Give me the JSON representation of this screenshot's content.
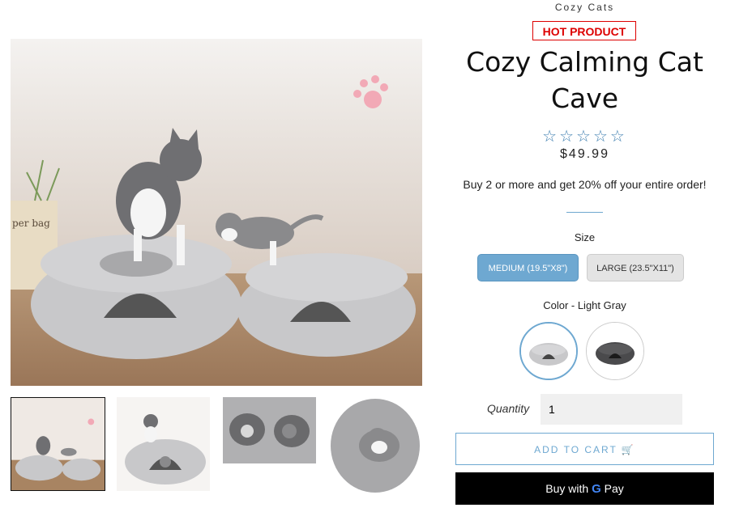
{
  "store": {
    "brand": "Cozy Cats"
  },
  "product": {
    "badge": "HOT PRODUCT",
    "title": "Cozy Calming Cat Cave",
    "rating_stars": "☆☆☆☆☆",
    "price": "$49.99",
    "promo": "Buy 2 or more and get 20% off your entire order!"
  },
  "size": {
    "label": "Size",
    "options": [
      "MEDIUM (19.5\"X8\")",
      "LARGE (23.5\"X11\")"
    ],
    "selected": "MEDIUM (19.5\"X8\")"
  },
  "color": {
    "label": "Color - Light Gray",
    "options": [
      "Light Gray",
      "Dark Gray"
    ],
    "selected": "Light Gray"
  },
  "quantity": {
    "label": "Quantity",
    "value": "1"
  },
  "actions": {
    "add_to_cart": "ADD TO CART 🛒",
    "buy_with": "Buy with",
    "gpay_g": "G",
    "gpay_pay": "Pay"
  },
  "colors": {
    "accent": "#6ea8d1",
    "badge_red": "#dd0000",
    "felt_light": "#c8c8ca",
    "felt_dark": "#4a4a4c"
  }
}
